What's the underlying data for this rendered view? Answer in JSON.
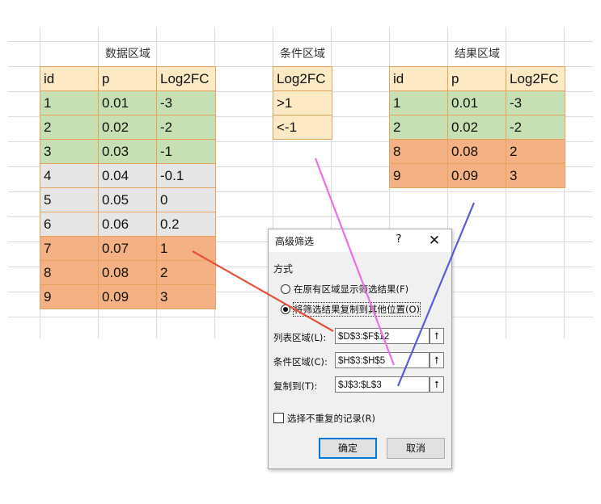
{
  "sheet": {
    "data_title": "数据区域",
    "criteria_title": "条件区域",
    "result_title": "结果区域",
    "data_headers": [
      "id",
      "p",
      "Log2FC"
    ],
    "data_rows": [
      [
        "1",
        "0.01",
        "-3"
      ],
      [
        "2",
        "0.02",
        "-2"
      ],
      [
        "3",
        "0.03",
        "-1"
      ],
      [
        "4",
        "0.04",
        "-0.1"
      ],
      [
        "5",
        "0.05",
        "0"
      ],
      [
        "6",
        "0.06",
        "0.2"
      ],
      [
        "7",
        "0.07",
        "1"
      ],
      [
        "8",
        "0.08",
        "2"
      ],
      [
        "9",
        "0.09",
        "3"
      ]
    ],
    "criteria_header": "Log2FC",
    "criteria_rows": [
      ">1",
      "<-1"
    ],
    "result_headers": [
      "id",
      "p",
      "Log2FC"
    ],
    "result_rows": [
      [
        "1",
        "0.01",
        "-3"
      ],
      [
        "2",
        "0.02",
        "-2"
      ],
      [
        "8",
        "0.08",
        "2"
      ],
      [
        "9",
        "0.09",
        "3"
      ]
    ]
  },
  "dialog": {
    "title": "高级筛选",
    "help_icon": "?",
    "close_icon": "✕",
    "method_label": "方式",
    "radio_inplace": "在原有区域显示筛选结果(F)",
    "radio_copy": "将筛选结果复制到其他位置(O)",
    "list_range_label": "列表区域(L):",
    "list_range_value": "$D$3:$F$12",
    "criteria_range_label": "条件区域(C):",
    "criteria_range_value": "$H$3:$H$5",
    "copy_to_label": "复制到(T):",
    "copy_to_value": "$J$3:$L$3",
    "unique_label": "选择不重复的记录(R)",
    "ok_label": "确定",
    "cancel_label": "取消",
    "range_picker_icon": "⭡"
  },
  "colors": {
    "header_fill": "#fde9c4",
    "green_fill": "#c6e0b4",
    "gray_fill": "#e7e6e6",
    "orange_fill": "#f4b183",
    "border": "#e8a25c",
    "arrow_red": "#e8503c",
    "arrow_pink": "#ee6ee8",
    "arrow_blue": "#5b5bd8",
    "ok_border": "#0078d7"
  }
}
